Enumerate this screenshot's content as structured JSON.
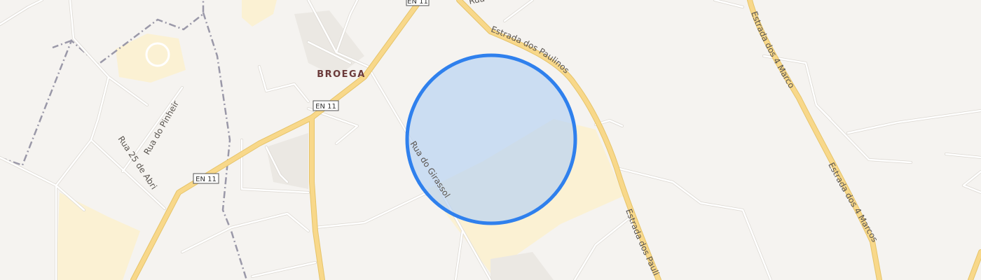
{
  "map": {
    "place_label": "BROEGA",
    "road_shields": [
      "EN 11",
      "EN 11",
      "EN 11"
    ],
    "street_labels": {
      "rua_prefix": "Rua",
      "estrada_paulinos_top": "Estrada dos Paulinos",
      "estrada_paulinos_bottom": "Estrada dos Paulinos",
      "estrada_4_marcos_top": "Estrada dos 4 Marcos",
      "estrada_4_marcos_bottom": "Estrada dos 4 Marcos",
      "rua_do_girassol": "Rua do Girassol",
      "rua_25_abril": "Rua 25 de Abril",
      "rua_do_pinheiro": "Rua do Pinheiro"
    },
    "colors": {
      "background": "#f5f3f0",
      "major_road": "#f8d88a",
      "major_road_casing": "#e6c46a",
      "minor_road": "#ffffff",
      "minor_road_casing": "#dcd8d2",
      "boundary": "#9a98a8",
      "landuse_yellow": "#fbf1d3",
      "landuse_grey": "#ebe8e3",
      "location_circle_fill": "#b9d3f2",
      "location_circle_stroke": "#2f80ed",
      "place_label": "#6b3a3a"
    },
    "location_marker": "accuracy-circle"
  }
}
